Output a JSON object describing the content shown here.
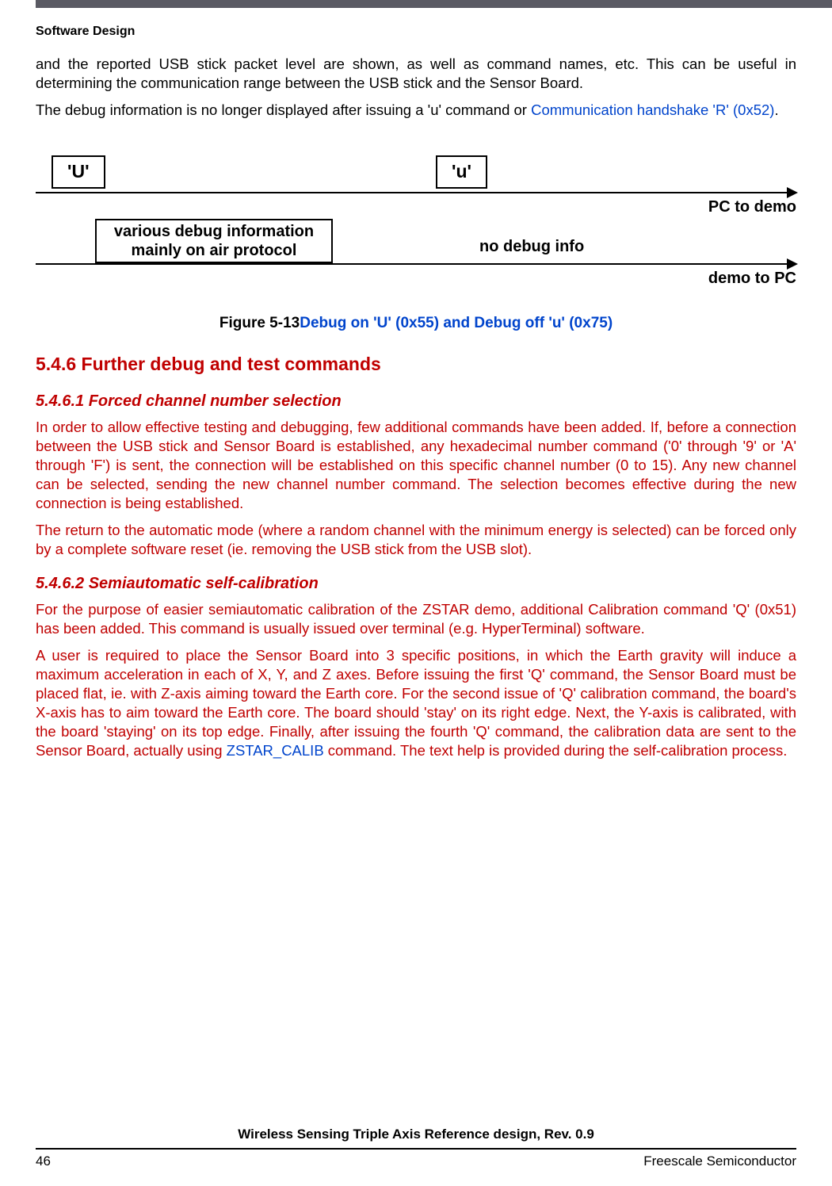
{
  "header": {
    "section": "Software Design"
  },
  "intro": {
    "p1": "and the reported USB stick packet level are shown, as well as command names, etc. This can be useful in determining the communication range between the USB stick and the Sensor Board.",
    "p2a": "The debug information is no longer displayed after issuing a 'u' command or ",
    "p2link": "Communication handshake 'R' (0x52)",
    "p2b": "."
  },
  "diagram": {
    "U": "'U'",
    "u": "'u'",
    "pc_to_demo": "PC to demo",
    "demo_to_pc": "demo to PC",
    "box_line1": "various debug information",
    "box_line2": "mainly on air protocol",
    "no_debug": "no debug info"
  },
  "figcap": {
    "prefix": "Figure 5-13",
    "title": "Debug on 'U' (0x55) and Debug off 'u' (0x75)"
  },
  "s546": {
    "title": "5.4.6  Further debug and test commands"
  },
  "s5461": {
    "title": "5.4.6.1  Forced channel number selection",
    "p1": "In order to allow effective testing and debugging, few additional commands have been added. If, before a connection between the USB stick and Sensor Board is established, any hexadecimal number command ('0' through '9' or 'A' through 'F') is sent, the connection will be established on this specific channel number (0 to 15). Any new channel can be selected, sending the new channel number command. The selection becomes effective during the new connection is being established.",
    "p2": "The return to the automatic mode (where a random channel with the minimum energy is selected) can be forced only by a complete software reset (ie. removing the USB stick from the USB slot)."
  },
  "s5462": {
    "title": "5.4.6.2  Semiautomatic self-calibration",
    "p1": "For the purpose of easier semiautomatic calibration of the ZSTAR demo, additional Calibration command 'Q' (0x51) has been added. This command is usually issued over terminal (e.g. HyperTerminal) software.",
    "p2a": "A user is required to place the Sensor Board into 3 specific positions, in which the Earth gravity will induce a maximum acceleration in each of X, Y, and Z axes. Before issuing the first 'Q' command, the Sensor Board must be placed flat, ie. with Z-axis aiming toward the Earth core. For the second issue of 'Q' calibration command, the board's X-axis has to aim toward the Earth core. The board should 'stay' on its right edge. Next, the Y-axis is calibrated, with the board 'staying' on its top edge. Finally, after issuing the fourth 'Q' command, the calibration data are sent to the Sensor Board, actually using ",
    "p2link": "ZSTAR_CALIB",
    "p2b": " command. The text help is provided during the self-calibration process."
  },
  "footer": {
    "doc": "Wireless Sensing Triple Axis Reference design, Rev. 0.9",
    "page": "46",
    "vendor": "Freescale Semiconductor"
  }
}
